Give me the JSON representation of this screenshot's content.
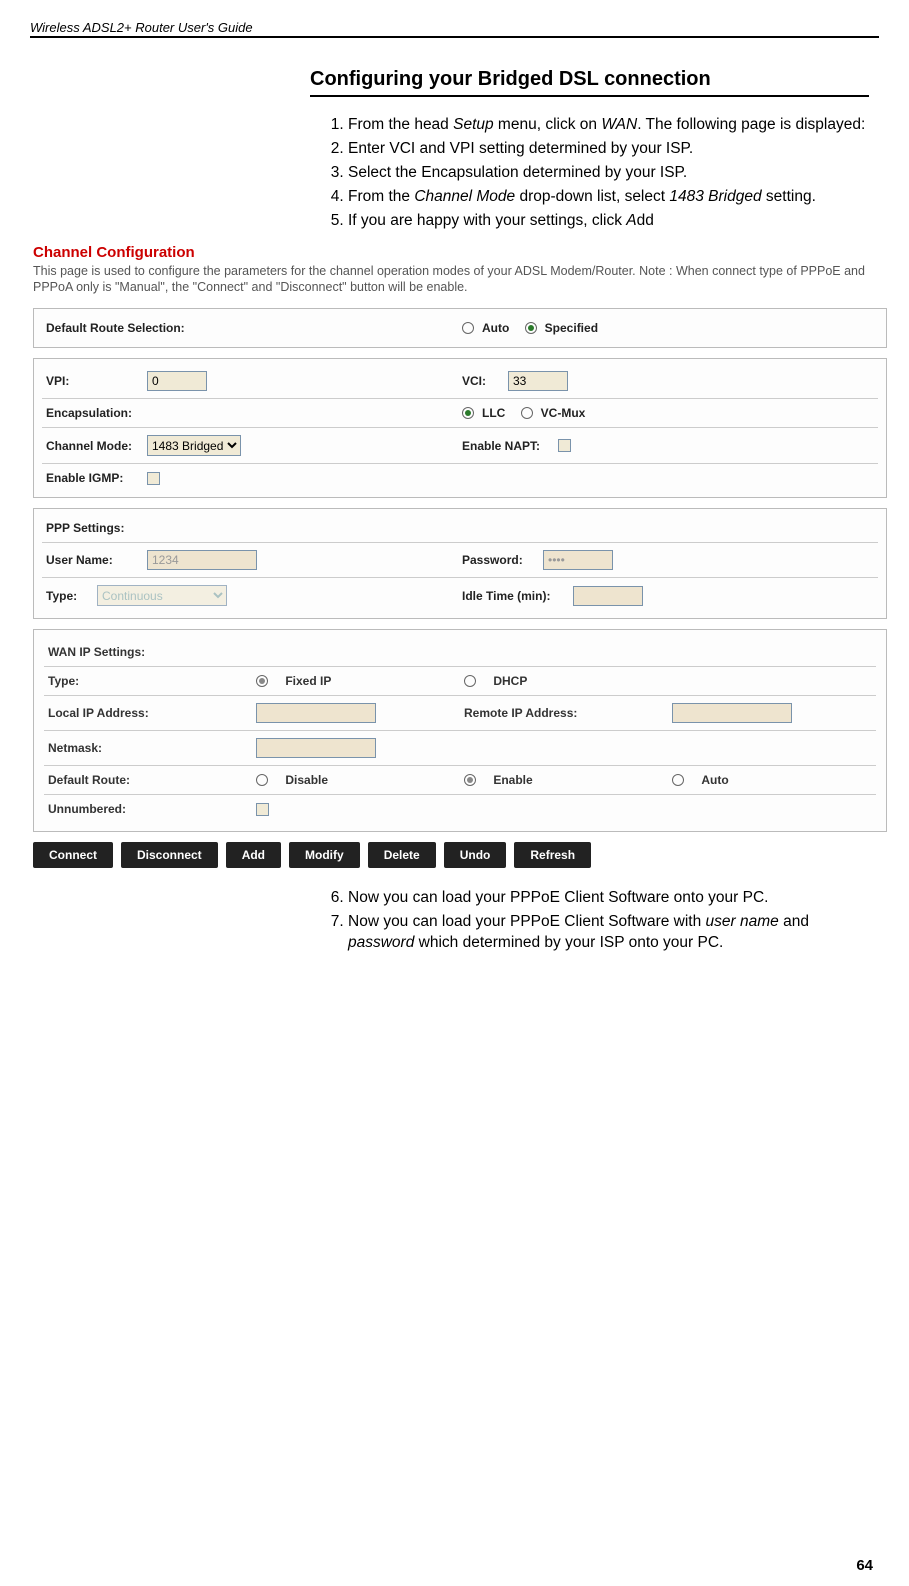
{
  "doc_header": "Wireless ADSL2+ Router User's Guide",
  "section_title": "Configuring your Bridged DSL connection",
  "steps_top": [
    "From the head <em>Setup</em> menu, click on <em>WAN</em>. The following page is displayed:",
    "Enter VCI and VPI setting determined by your ISP.",
    "Select the Encapsulation determined by your ISP.",
    "From the <em>Channel Mode</em> drop-down list, select <em>1483 Bridged</em> setting.",
    "If you are happy with your settings, click <em>A</em>dd"
  ],
  "steps_bottom": [
    "Now you can load your PPPoE Client Software onto your PC.",
    "Now you can load your PPPoE Client Software with <em>user name</em> and <em>password</em> which determined by your ISP onto your PC."
  ],
  "cc": {
    "title": "Channel Configuration",
    "desc": "This page is used to configure the parameters for the channel operation modes of your ADSL Modem/Router. Note : When connect type of PPPoE and PPPoA only is \"Manual\", the \"Connect\" and \"Disconnect\" button will be enable.",
    "default_route_label": "Default Route Selection:",
    "auto": "Auto",
    "specified": "Specified",
    "vpi_label": "VPI:",
    "vpi_value": "0",
    "vci_label": "VCI:",
    "vci_value": "33",
    "encap_label": "Encapsulation:",
    "llc": "LLC",
    "vcmux": "VC-Mux",
    "mode_label": "Channel Mode:",
    "mode_value": "1483 Bridged",
    "napt_label": "Enable NAPT:",
    "igmp_label": "Enable IGMP:",
    "ppp_label": "PPP Settings:",
    "user_label": "User Name:",
    "user_value": "1234",
    "pass_label": "Password:",
    "pass_value": "••••",
    "type_label": "Type:",
    "type_value": "Continuous",
    "idle_label": "Idle Time (min):",
    "wan_label": "WAN IP Settings:",
    "wan_type_label": "Type:",
    "fixed_ip": "Fixed IP",
    "dhcp": "DHCP",
    "local_ip": "Local IP Address:",
    "remote_ip": "Remote IP Address:",
    "netmask": "Netmask:",
    "defroute": "Default Route:",
    "disable": "Disable",
    "enable": "Enable",
    "auto2": "Auto",
    "unnum": "Unnumbered:",
    "buttons": [
      "Connect",
      "Disconnect",
      "Add",
      "Modify",
      "Delete",
      "Undo",
      "Refresh"
    ]
  },
  "page_num": "64"
}
